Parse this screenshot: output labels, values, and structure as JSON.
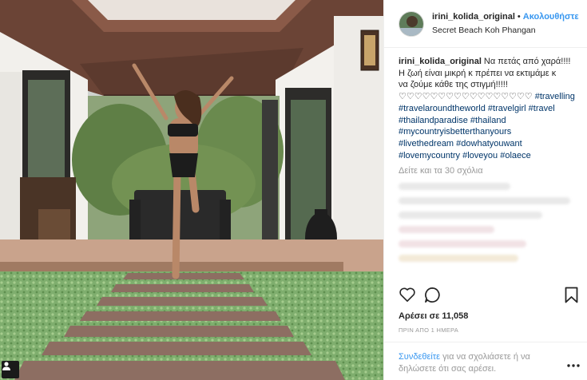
{
  "post": {
    "username": "irini_kolida_original",
    "follow_label": "Ακολουθήστε",
    "location": "Secret Beach Koh Phangan",
    "caption_lines": [
      "Να πετάς από χαρά!!!!",
      "Η ζωή είναι μικρή κ πρέπει να εκτιμάμε κ",
      "να ζούμε κάθε της στιγμή!!!!!",
      "♡♡♡♡♡♡♡♡♡♡♡♡♡♡♡♡♡"
    ],
    "hashtags": [
      "#travelling",
      "#travelaroundtheworld",
      "#travelgirl",
      "#travel",
      "#thailandparadise",
      "#thailand",
      "#mycountryisbetterthanyours",
      "#livethedream",
      "#dowhatyouwant",
      "#lovemycountry",
      "#loveyou",
      "#olaece"
    ],
    "view_all_comments": "Δείτε και τα 30 σχόλια",
    "likes": "Αρέσει σε 11,058",
    "time": "ΠΡΙΝ ΑΠΟ 1 ΗΜΕΡΑ",
    "login_link": "Συνδεθείτε",
    "login_rest": " για να σχολιάσετε ή να δηλώσετε ότι σας αρέσει."
  },
  "icons": {
    "like": "heart-icon",
    "comment": "comment-bubble-icon",
    "save": "bookmark-icon",
    "more": "more-options-icon",
    "photo_badge": "user-tag-icon"
  },
  "colors": {
    "link_blue": "#3897f0",
    "hashtag_navy": "#003569",
    "muted_gray": "#999999",
    "text": "#262626"
  }
}
